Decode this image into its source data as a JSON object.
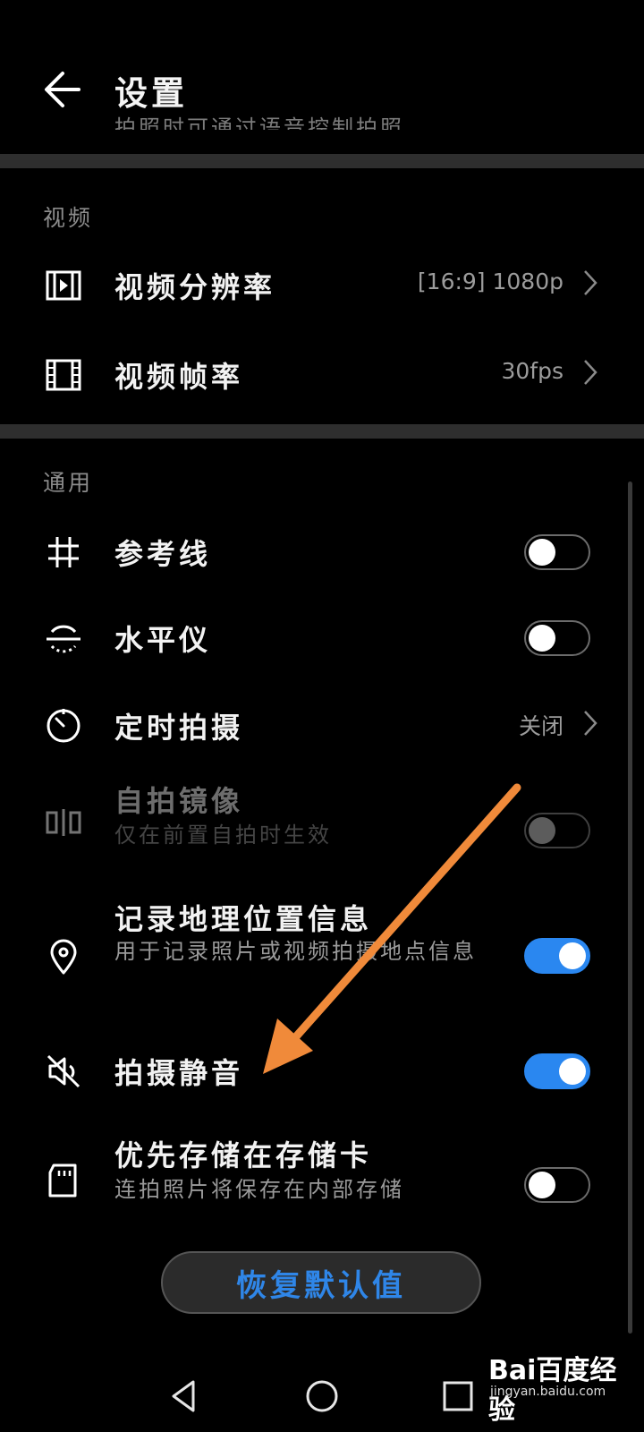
{
  "header": {
    "title": "设置",
    "peek_text": "拍照时可通过语音控制拍照"
  },
  "sections": {
    "video": {
      "title": "视频",
      "resolution": {
        "label": "视频分辨率",
        "value": "[16:9] 1080p"
      },
      "framerate": {
        "label": "视频帧率",
        "value": "30fps"
      }
    },
    "general": {
      "title": "通用",
      "grid": {
        "label": "参考线",
        "enabled": false
      },
      "level": {
        "label": "水平仪",
        "enabled": false
      },
      "timer": {
        "label": "定时拍摄",
        "value": "关闭"
      },
      "mirror": {
        "label": "自拍镜像",
        "sub": "仅在前置自拍时生效",
        "enabled": false,
        "disabled": true
      },
      "location": {
        "label": "记录地理位置信息",
        "sub": "用于记录照片或视频拍摄地点信息",
        "enabled": true
      },
      "mute": {
        "label": "拍摄静音",
        "enabled": true
      },
      "sdcard": {
        "label": "优先存储在存储卡",
        "sub": "连拍照片将保存在内部存储",
        "enabled": false
      }
    }
  },
  "restore_label": "恢复默认值",
  "watermark": {
    "logo": "Bai百度经验",
    "sub": "jingyan.baidu.com"
  },
  "colors": {
    "accent": "#2a87f0",
    "annotation_arrow": "#f08a3a"
  },
  "icons": [
    "back-arrow-icon",
    "video-resolution-icon",
    "film-icon",
    "grid-icon",
    "level-icon",
    "timer-icon",
    "mirror-icon",
    "location-pin-icon",
    "mute-speaker-icon",
    "sd-card-icon"
  ]
}
